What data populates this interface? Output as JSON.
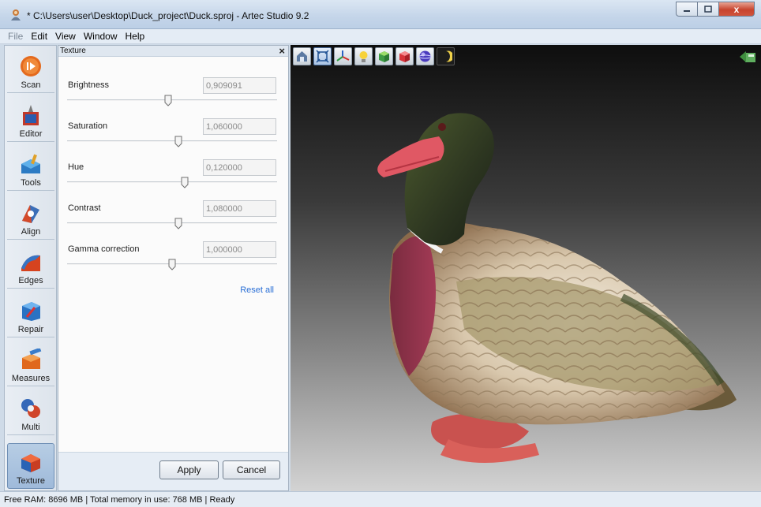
{
  "window": {
    "title": "* C:\\Users\\user\\Desktop\\Duck_project\\Duck.sproj - Artec Studio 9.2",
    "controls": {
      "minimize": "minimize-icon",
      "maximize": "maximize-icon",
      "close": "x"
    }
  },
  "menu": {
    "items": [
      "File",
      "Edit",
      "View",
      "Window",
      "Help"
    ]
  },
  "lefttools": {
    "items": [
      {
        "label": "Scan",
        "icon": "scan-icon"
      },
      {
        "label": "Editor",
        "icon": "editor-icon"
      },
      {
        "label": "Tools",
        "icon": "tools-icon"
      },
      {
        "label": "Align",
        "icon": "align-icon"
      },
      {
        "label": "Edges",
        "icon": "edges-icon"
      },
      {
        "label": "Repair",
        "icon": "repair-icon"
      },
      {
        "label": "Measures",
        "icon": "measures-icon"
      },
      {
        "label": "Multi",
        "icon": "multi-icon"
      },
      {
        "label": "Texture",
        "icon": "texture-icon",
        "active": true
      }
    ]
  },
  "panel": {
    "title": "Texture",
    "close_glyph": "×",
    "params": [
      {
        "label": "Brightness",
        "value": "0,909091",
        "slider": 0.48
      },
      {
        "label": "Saturation",
        "value": "1,060000",
        "slider": 0.53
      },
      {
        "label": "Hue",
        "value": "0,120000",
        "slider": 0.56
      },
      {
        "label": "Contrast",
        "value": "1,080000",
        "slider": 0.53
      },
      {
        "label": "Gamma correction",
        "value": "1,000000",
        "slider": 0.5
      }
    ],
    "reset_label": "Reset all",
    "apply_label": "Apply",
    "cancel_label": "Cancel"
  },
  "viewport": {
    "toolbar": [
      "home-view-icon",
      "fit-to-screen-icon",
      "axes-icon",
      "light-bulb-icon",
      "texture-cube-icon",
      "solid-cube-icon",
      "sphere-icon",
      "moon-icon"
    ],
    "back_icon": "back-arrow-icon"
  },
  "status": {
    "text": "Free RAM: 8696 MB  |  Total memory in use: 768 MB  |   Ready"
  }
}
